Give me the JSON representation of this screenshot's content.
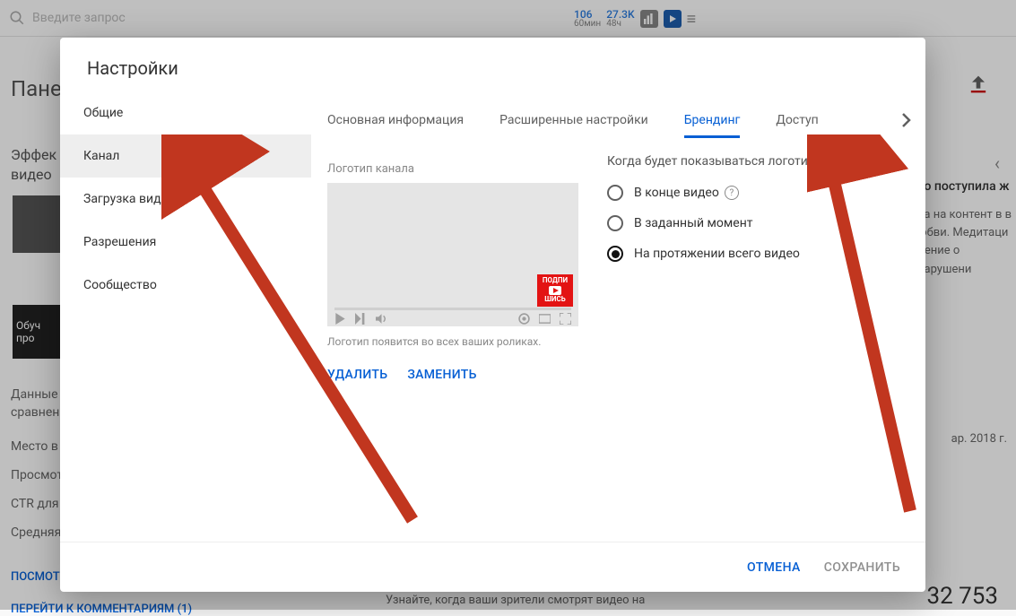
{
  "bg": {
    "search_placeholder": "Введите запрос",
    "stat1_num": "106",
    "stat1_sub": "60мин",
    "stat2_num": "27.3K",
    "stat2_sub": "48ч",
    "title": "Панел",
    "subtitle": "Эффек\nвидео",
    "thumb2_text": "Обуч\nпро",
    "line1": "Данные з",
    "line2": "сравнени",
    "line3": "Место в р",
    "line4": "Просмотр",
    "line5": "CTR для",
    "line6": "Средняя",
    "link1": "ПОСМОТ",
    "link2": "ПЕРЕЙТИ К КОММЕНТАРИЯМ (1)",
    "right_title": "ео поступила ж",
    "right_t1": "ва на контент в в",
    "right_t2": "юбви. Медитаци",
    "right_t3": "дение о нарушени",
    "right_date": "ар. 2018 г.",
    "right_big": "32 753",
    "bottom_text": "Узнайте, когда ваши зрители смотрят видео на"
  },
  "modal": {
    "title": "Настройки",
    "sidebar": {
      "items": [
        {
          "label": "Общие"
        },
        {
          "label": "Канал"
        },
        {
          "label": "Загрузка видео"
        },
        {
          "label": "Разрешения"
        },
        {
          "label": "Сообщество"
        }
      ],
      "active_index": 1
    },
    "tabs": {
      "items": [
        {
          "label": "Основная информация"
        },
        {
          "label": "Расширенные настройки"
        },
        {
          "label": "Брендинг"
        },
        {
          "label": "Доступ"
        }
      ],
      "active_index": 2
    },
    "branding": {
      "section_label": "Логотип канала",
      "logo_text_top": "ПОДПИ",
      "logo_text_bot": "ШИСЬ",
      "helper": "Логотип появится во всех ваших роликах.",
      "delete_label": "УДАЛИТЬ",
      "replace_label": "ЗАМЕНИТЬ",
      "when_title": "Когда будет показываться логотип",
      "radios": [
        {
          "label": "В конце видео",
          "help": true
        },
        {
          "label": "В заданный момент",
          "help": false
        },
        {
          "label": "На протяжении всего видео",
          "help": false
        }
      ],
      "selected_radio": 2
    },
    "footer": {
      "cancel": "ОТМЕНА",
      "save": "СОХРАНИТЬ"
    }
  }
}
